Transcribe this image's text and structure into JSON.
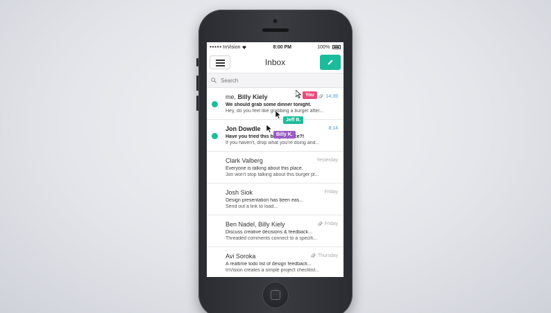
{
  "status": {
    "carrier": "InVision",
    "time": "8:00 PM",
    "battery": "100%"
  },
  "nav": {
    "title": "Inbox"
  },
  "search": {
    "placeholder": "Search"
  },
  "emails": [
    {
      "sender_prefix": "me, ",
      "sender": "Billy Kiely",
      "subject": "We should grab some dinner tonight.",
      "preview": "Hey, do you feel like grabbing a burger after...",
      "time": "14:39",
      "unread": true,
      "attachment": true
    },
    {
      "sender_prefix": "",
      "sender": "Jon Dowdle",
      "subject": "Have you tried this burger place?!",
      "preview": "If you haven't, drop what you're doing and...",
      "time": "8:14",
      "unread": true,
      "attachment": false
    },
    {
      "sender_prefix": "",
      "sender": "Clark Valberg",
      "subject": "Everyone is talking about this place.",
      "preview": "Jon won't stop talking about this burger pl...",
      "time": "Yesterday",
      "unread": false,
      "attachment": false
    },
    {
      "sender_prefix": "",
      "sender": "Josh Siok",
      "subject": "Design presentation has been eas...",
      "preview": "Send out a link to load...",
      "time": "Friday",
      "unread": false,
      "attachment": false
    },
    {
      "sender_prefix": "",
      "sender": "Ben Nadel, Billy Kiely",
      "subject": "Discuss creative decisions & feedback...",
      "preview": "Threaded comments connect to a specifi...",
      "time": "Friday",
      "unread": false,
      "attachment": true
    },
    {
      "sender_prefix": "",
      "sender": "Avi Soroka",
      "subject": "A realtime todo list of design feedback...",
      "preview": "InVision creates a simple project checklist...",
      "time": "Thursday",
      "unread": false,
      "attachment": true
    }
  ],
  "collaborators": [
    {
      "name": "You",
      "color": "#e94b7a"
    },
    {
      "name": "Jeff B.",
      "color": "#1bbc9b"
    },
    {
      "name": "Billy K.",
      "color": "#9b59c6"
    }
  ],
  "colors": {
    "accent": "#1bbc9b",
    "time_accent": "#3aa0e0",
    "phone_body": "#2f3136"
  },
  "icons": {
    "menu": "hamburger-icon",
    "compose": "pencil-icon",
    "search": "search-icon",
    "attachment": "paperclip-icon",
    "wifi": "wifi-icon",
    "battery": "battery-icon",
    "cursor": "cursor-icon"
  }
}
